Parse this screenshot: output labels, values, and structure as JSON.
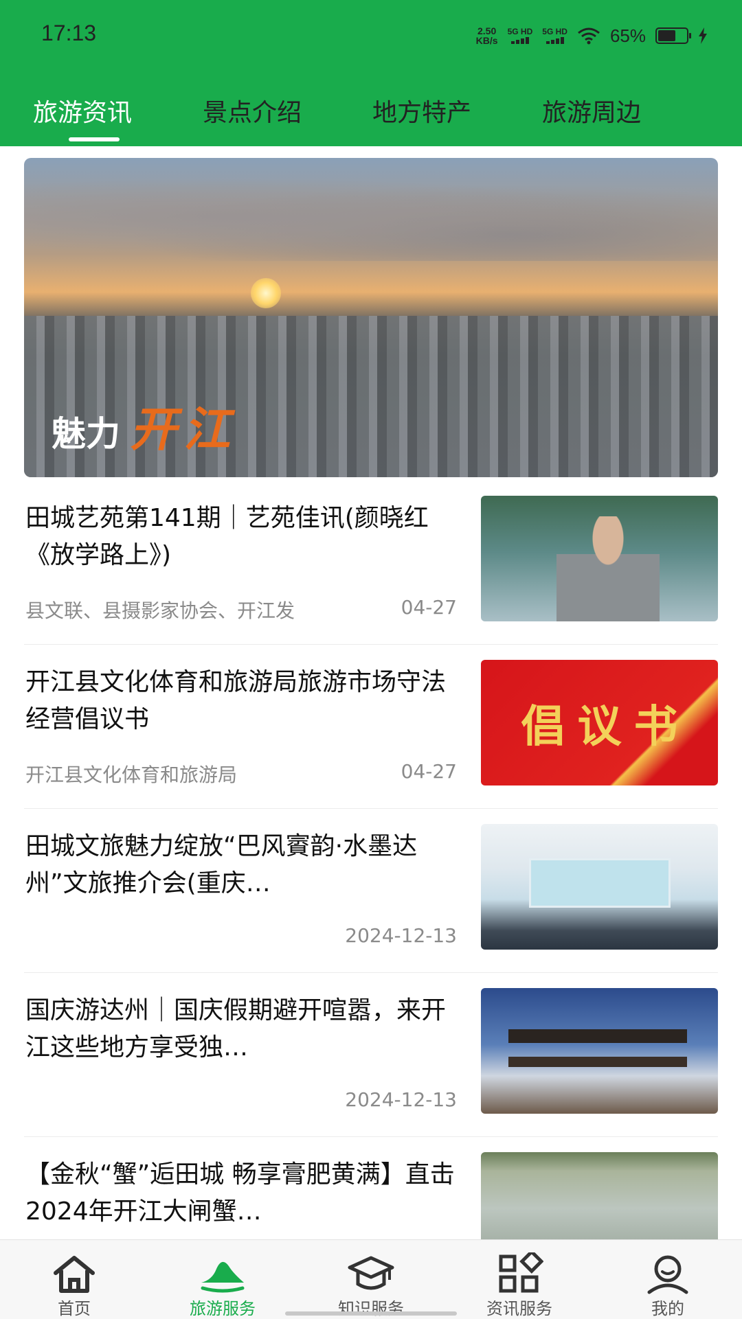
{
  "status_bar": {
    "time": "17:13",
    "net_speed_value": "2.50",
    "net_speed_unit": "KB/s",
    "signal_1": "5G HD",
    "signal_2": "5G HD",
    "battery_percent": "65%",
    "battery_level": 0.65
  },
  "tabs": [
    {
      "label": "旅游资讯",
      "active": true
    },
    {
      "label": "景点介绍",
      "active": false
    },
    {
      "label": "地方特产",
      "active": false
    },
    {
      "label": "旅游周边",
      "active": false
    }
  ],
  "banner": {
    "title_part1": "魅力",
    "title_part2": "开江"
  },
  "news": [
    {
      "title": "田城艺苑第141期｜艺苑佳讯(颜晓红《放学路上》)",
      "source": "县文联、县摄影家协会、开江发",
      "date": "04-27"
    },
    {
      "title": "开江县文化体育和旅游局旅游市场守法经营倡议书",
      "source": "开江县文化体育和旅游局",
      "date": "04-27",
      "thumb_text": "倡议书"
    },
    {
      "title": "田城文旅魅力绽放“巴风賨韵·水墨达州”文旅推介会(重庆…",
      "source": "",
      "date": "2024-12-13"
    },
    {
      "title": "国庆游达州｜国庆假期避开喧嚣，来开江这些地方享受独…",
      "source": "",
      "date": "2024-12-13"
    },
    {
      "title": "【金秋“蟹”逅田城 畅享膏肥黄满】直击2024年开江大闸蟹…",
      "source": "",
      "date": ""
    }
  ],
  "bottom_nav": [
    {
      "label": "首页",
      "icon": "home-icon",
      "active": false
    },
    {
      "label": "旅游服务",
      "icon": "mountain-icon",
      "active": true
    },
    {
      "label": "知识服务",
      "icon": "graduation-cap-icon",
      "active": false
    },
    {
      "label": "资讯服务",
      "icon": "grid-icon",
      "active": false
    },
    {
      "label": "我的",
      "icon": "user-icon",
      "active": false
    }
  ],
  "colors": {
    "brand_green": "#19AC4C",
    "banner_title_accent": "#E86B1C"
  }
}
